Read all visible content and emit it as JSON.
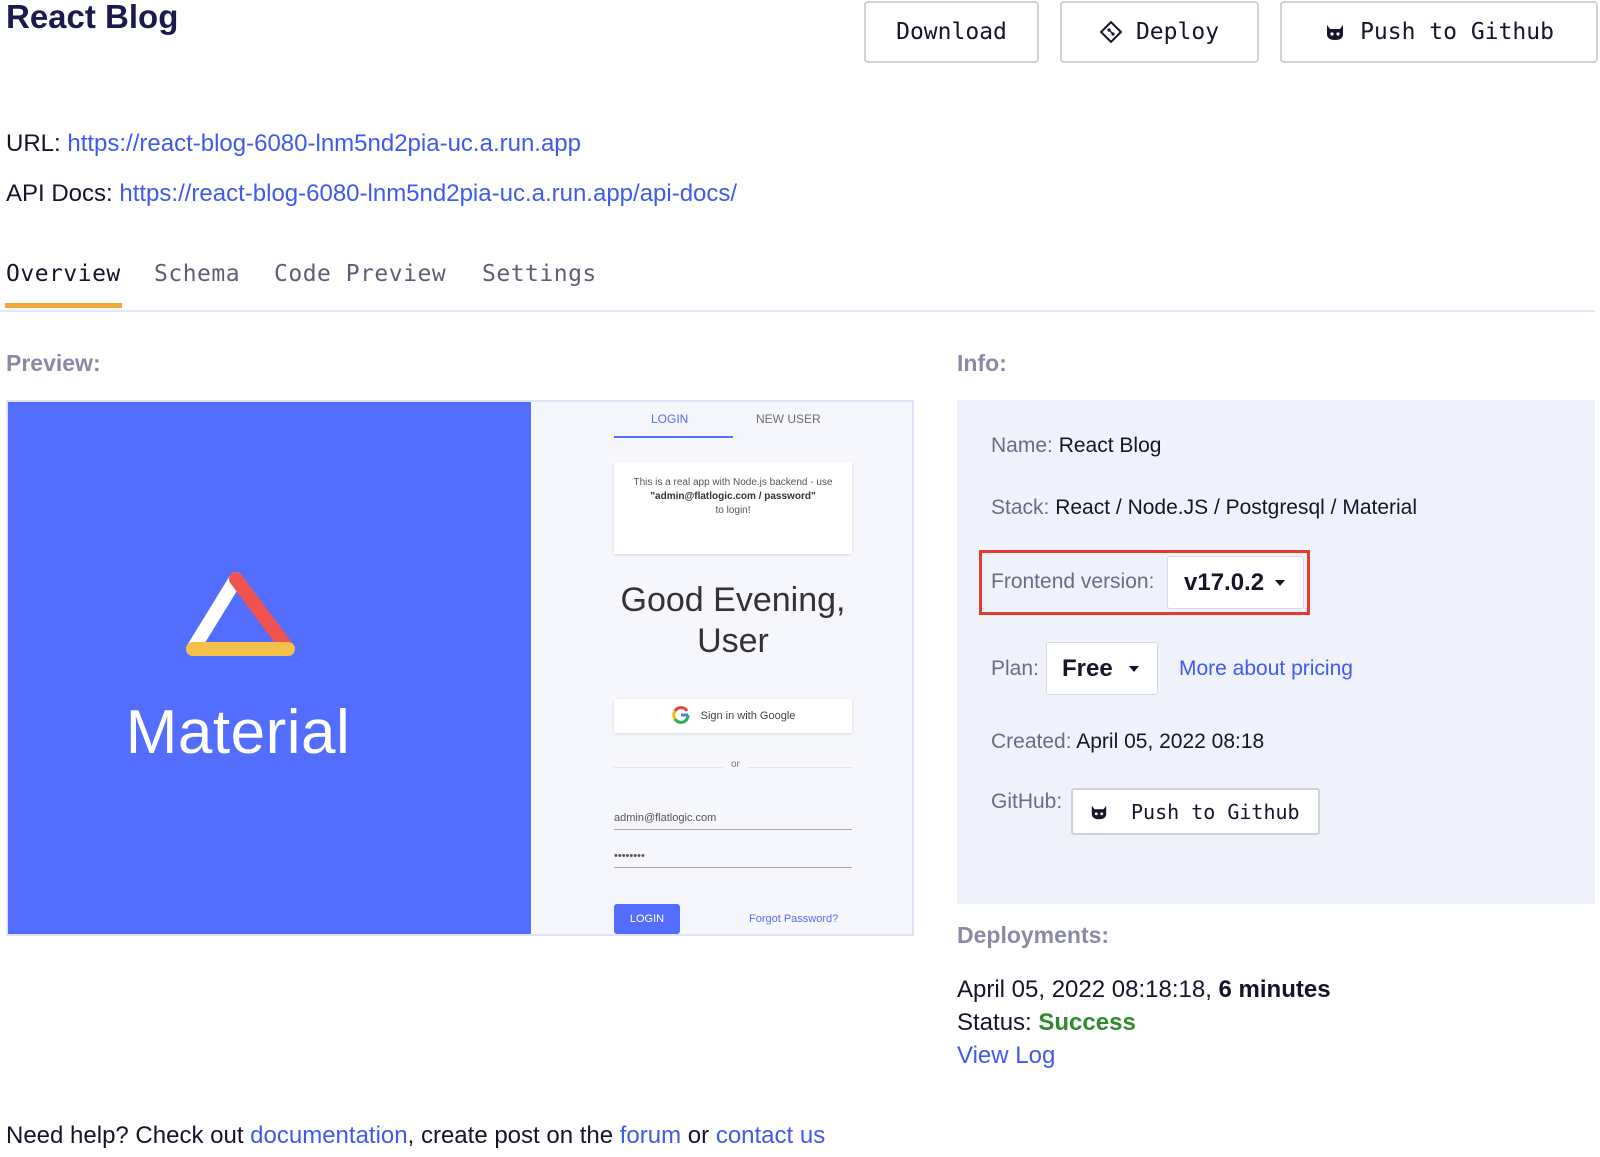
{
  "header": {
    "title": "React Blog",
    "download_label": "Download",
    "deploy_label": "Deploy",
    "push_label": "Push to Github"
  },
  "links": {
    "url_label": "URL:",
    "url": "https://react-blog-6080-lnm5nd2pia-uc.a.run.app",
    "api_label": "API Docs:",
    "api_url": "https://react-blog-6080-lnm5nd2pia-uc.a.run.app/api-docs/"
  },
  "tabs": [
    {
      "label": "Overview",
      "active": true
    },
    {
      "label": "Schema",
      "active": false
    },
    {
      "label": "Code Preview",
      "active": false
    },
    {
      "label": "Settings",
      "active": false
    }
  ],
  "preview": {
    "label": "Preview:",
    "brand": "Material",
    "tab_login": "LOGIN",
    "tab_new_user": "NEW USER",
    "note_line1": "This is a real app with Node.js backend - use",
    "note_creds": "\"admin@flatlogic.com / password\"",
    "note_line3": "to login!",
    "greeting_line1": "Good Evening,",
    "greeting_line2": "User",
    "google_label": "Sign in with Google",
    "or_label": "or",
    "email_value": "admin@flatlogic.com",
    "password_value": "••••••••",
    "login_button": "LOGIN",
    "forgot_link": "Forgot Password?",
    "brand_color": "#536dfe"
  },
  "info": {
    "label": "Info:",
    "name_key": "Name:",
    "name_value": "React Blog",
    "stack_key": "Stack:",
    "stack_value": "React / Node.JS / Postgresql / Material",
    "frontend_key": "Frontend version:",
    "frontend_value": "v17.0.2",
    "plan_key": "Plan:",
    "plan_value": "Free",
    "pricing_link": "More about pricing",
    "created_key": "Created:",
    "created_value": "April 05, 2022 08:18",
    "github_key": "GitHub:",
    "github_button": "Push to Github"
  },
  "deployments": {
    "label": "Deployments:",
    "date": "April 05, 2022 08:18:18,",
    "duration": "6 minutes",
    "status_key": "Status:",
    "status_value": "Success",
    "view_log": "View Log"
  },
  "help": {
    "prefix": "Need help? Check out",
    "documentation": "documentation",
    "middle": ", create post on the",
    "forum": "forum",
    "or": "or",
    "contact": "contact us"
  },
  "colors": {
    "link": "#3d5af1",
    "tab_accent": "#f2a93b",
    "highlight_border": "#e53b2c",
    "success": "#2e8b2e"
  },
  "icons": {
    "deploy": "git-diamond-icon",
    "push": "github-cat-icon",
    "google": "google-g-icon",
    "caret": "chevron-down-icon"
  }
}
